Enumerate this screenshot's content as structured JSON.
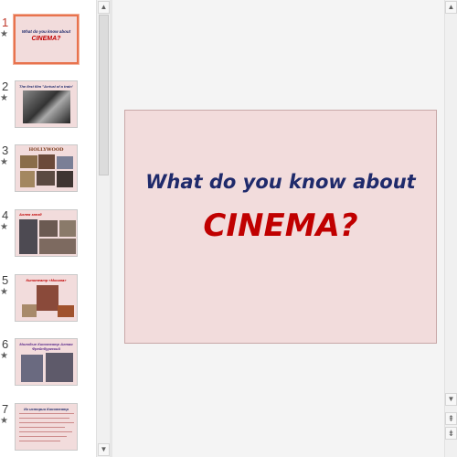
{
  "thumbnails": [
    {
      "number": "1",
      "star": "★",
      "lines": [
        "What do you know about",
        "CINEMA?"
      ]
    },
    {
      "number": "2",
      "star": "★",
      "lines": [
        "The first film \"Arrival of a train\""
      ]
    },
    {
      "number": "3",
      "star": "★",
      "lines": [
        "HOLLYWOOD"
      ]
    },
    {
      "number": "4",
      "star": "★",
      "lines": [
        "Аллея звезд"
      ]
    },
    {
      "number": "5",
      "star": "★",
      "lines": [
        "Кинотеатр «Москва»"
      ]
    },
    {
      "number": "6",
      "star": "★",
      "lines": [
        "Молодые Кинотеатр Алтая",
        "Фрейнбургский"
      ]
    },
    {
      "number": "7",
      "star": "★",
      "lines": [
        "Из истории Кинотеатр"
      ]
    }
  ],
  "slide": {
    "line1": "What do you know about",
    "line2": "CINEMA?"
  },
  "icons": {
    "scroll_up": "▲",
    "scroll_down": "▼",
    "prev_slide": "⇞",
    "next_slide": "⇟"
  },
  "colors": {
    "slide_bg": "#f2dcdc",
    "title_blue": "#1f2a6b",
    "title_red": "#c00000",
    "selection": "#e8734e"
  }
}
